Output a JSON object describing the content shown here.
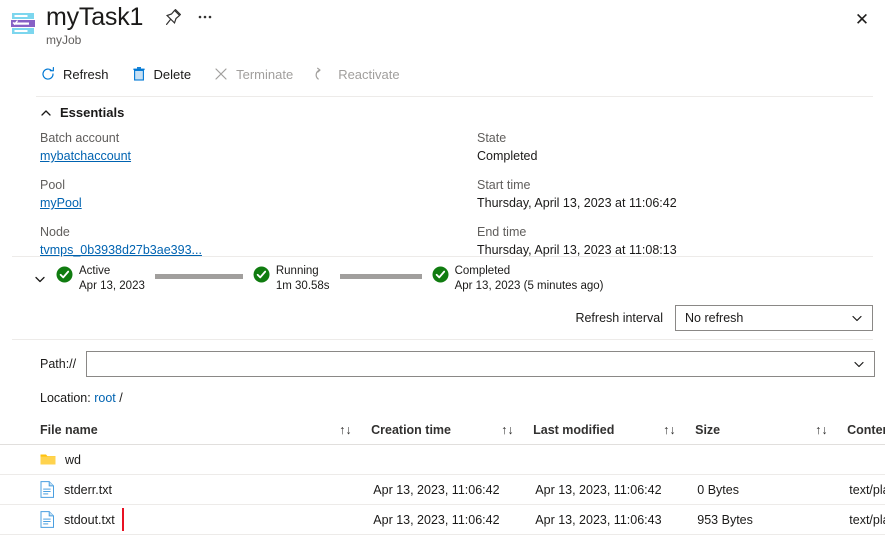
{
  "header": {
    "title": "myTask1",
    "subtitle": "myJob",
    "task_icon": "batch-task-icon",
    "pin_icon": "pin-icon",
    "more_icon": "ellipsis-icon",
    "close_icon": "close-icon",
    "close_glyph": "✕"
  },
  "toolbar": {
    "items": [
      {
        "label": "Refresh",
        "icon": "refresh-icon",
        "disabled": false
      },
      {
        "label": "Delete",
        "icon": "trash-icon",
        "disabled": false
      },
      {
        "label": "Terminate",
        "icon": "cross-icon",
        "disabled": true
      },
      {
        "label": "Reactivate",
        "icon": "reactivate-icon",
        "disabled": true
      }
    ]
  },
  "essentials": {
    "heading": "Essentials",
    "chevron": "chevron-up-icon",
    "left": [
      {
        "label": "Batch account",
        "value": "mybatchaccount",
        "link": true
      },
      {
        "label": "Pool",
        "value": "myPool",
        "link": true
      },
      {
        "label": "Node",
        "value": "tvmps_0b3938d27b3ae393...",
        "link": true
      }
    ],
    "right": [
      {
        "label": "State",
        "value": "Completed",
        "link": false
      },
      {
        "label": "Start time",
        "value": "Thursday, April 13, 2023 at 11:06:42",
        "link": false
      },
      {
        "label": "End time",
        "value": "Thursday, April 13, 2023 at 11:08:13",
        "link": false
      }
    ]
  },
  "timeline": {
    "expander": "chevron-down-icon",
    "stages": [
      {
        "name": "Active",
        "sub": "Apr 13, 2023",
        "status": "complete"
      },
      {
        "name": "Running",
        "sub": "1m 30.58s",
        "status": "complete"
      },
      {
        "name": "Completed",
        "sub": "Apr 13, 2023 (5 minutes ago)",
        "status": "complete"
      }
    ]
  },
  "refresh": {
    "label": "Refresh interval",
    "value": "No refresh",
    "chevron": "chevron-down-icon"
  },
  "path": {
    "label": "Path://",
    "value": "",
    "placeholder": "",
    "chevron": "chevron-down-icon"
  },
  "location": {
    "prefix": "Location:",
    "root": "root",
    "separator": "/"
  },
  "files": {
    "columns": [
      {
        "label": "File name",
        "sort": "↑↓"
      },
      {
        "label": "Creation time",
        "sort": "↑↓"
      },
      {
        "label": "Last modified",
        "sort": "↑↓"
      },
      {
        "label": "Size",
        "sort": "↑↓"
      },
      {
        "label": "Conten",
        "sort": ""
      }
    ],
    "rows": [
      {
        "name": "wd",
        "icon": "folder-icon",
        "creation_time": "",
        "last_modified": "",
        "size": "",
        "content_type": "",
        "highlighted": false
      },
      {
        "name": "stderr.txt",
        "icon": "file-icon",
        "creation_time": "Apr 13, 2023, 11:06:42",
        "last_modified": "Apr 13, 2023, 11:06:42",
        "size": "0 Bytes",
        "content_type": "text/pla",
        "highlighted": false
      },
      {
        "name": "stdout.txt",
        "icon": "file-icon",
        "creation_time": "Apr 13, 2023, 11:06:42",
        "last_modified": "Apr 13, 2023, 11:06:43",
        "size": "953 Bytes",
        "content_type": "text/pla",
        "highlighted": true
      }
    ]
  },
  "colors": {
    "link": "#0063b1",
    "success": "#107c10",
    "highlight": "#e81123",
    "disabled_text": "#a19f9d",
    "folder": "#ffc20e"
  }
}
